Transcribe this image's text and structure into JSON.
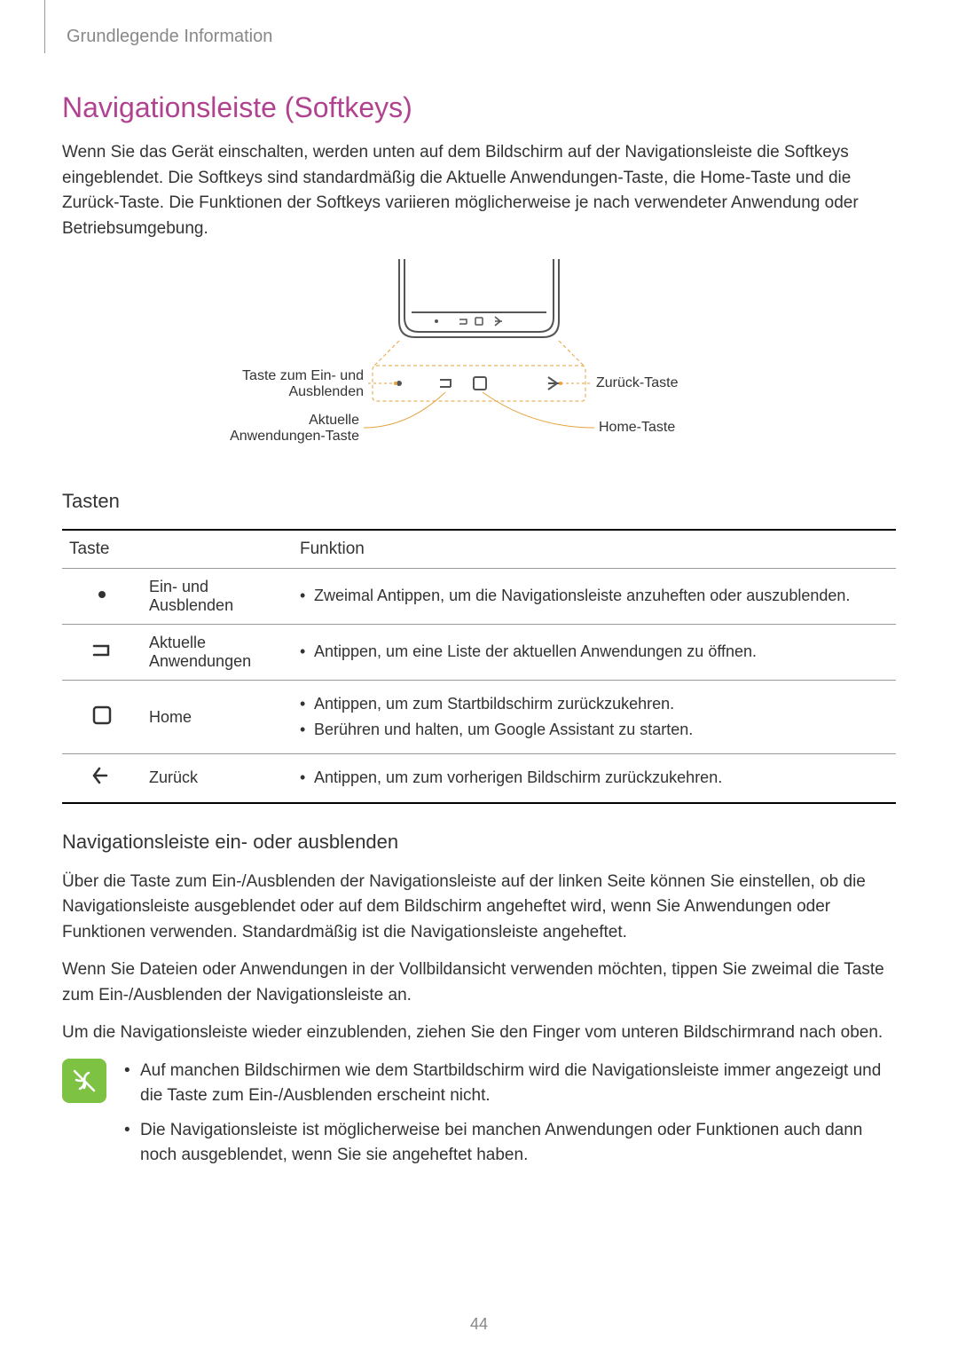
{
  "chapter": "Grundlegende Information",
  "heading": "Navigationsleiste (Softkeys)",
  "intro": "Wenn Sie das Gerät einschalten, werden unten auf dem Bildschirm auf der Navigationsleiste die Softkeys eingeblendet. Die Softkeys sind standardmäßig die Aktuelle Anwendungen-Taste, die Home-Taste und die Zurück-Taste. Die Funktionen der Softkeys variieren möglicherweise je nach verwendeter Anwendung oder Betriebsumgebung.",
  "diagram_labels": {
    "hide": "Taste zum Ein- und Ausblenden",
    "recent": "Aktuelle Anwendungen-Taste",
    "back": "Zurück-Taste",
    "home": "Home-Taste"
  },
  "table": {
    "title": "Tasten",
    "headers": {
      "key": "Taste",
      "func": "Funktion"
    },
    "rows": [
      {
        "icon": "dot",
        "name": "Ein- und Ausblenden",
        "funcs": [
          "Zweimal Antippen, um die Navigationsleiste anzuheften oder auszublenden."
        ]
      },
      {
        "icon": "recent",
        "name": "Aktuelle Anwendungen",
        "funcs": [
          "Antippen, um eine Liste der aktuellen Anwendungen zu öffnen."
        ]
      },
      {
        "icon": "home",
        "name": "Home",
        "funcs": [
          "Antippen, um zum Startbildschirm zurückzukehren.",
          "Berühren und halten, um Google Assistant zu starten."
        ]
      },
      {
        "icon": "back",
        "name": "Zurück",
        "funcs": [
          "Antippen, um zum vorherigen Bildschirm zurückzukehren."
        ]
      }
    ]
  },
  "sub_heading": "Navigationsleiste ein- oder ausblenden",
  "para1": "Über die Taste zum Ein-/Ausblenden der Navigationsleiste auf der linken Seite können Sie einstellen, ob die Navigationsleiste ausgeblendet oder auf dem Bildschirm angeheftet wird, wenn Sie Anwendungen oder Funktionen verwenden. Standardmäßig ist die Navigationsleiste angeheftet.",
  "para2": "Wenn Sie Dateien oder Anwendungen in der Vollbildansicht verwenden möchten, tippen Sie zweimal die Taste zum Ein-/Ausblenden der Navigationsleiste an.",
  "para3": "Um die Navigationsleiste wieder einzublenden, ziehen Sie den Finger vom unteren Bildschirmrand nach oben.",
  "notes": [
    "Auf manchen Bildschirmen wie dem Startbildschirm wird die Navigationsleiste immer angezeigt und die Taste zum Ein-/Ausblenden erscheint nicht.",
    "Die Navigationsleiste ist möglicherweise bei manchen Anwendungen oder Funktionen auch dann noch ausgeblendet, wenn Sie sie angeheftet haben."
  ],
  "page_number": "44"
}
